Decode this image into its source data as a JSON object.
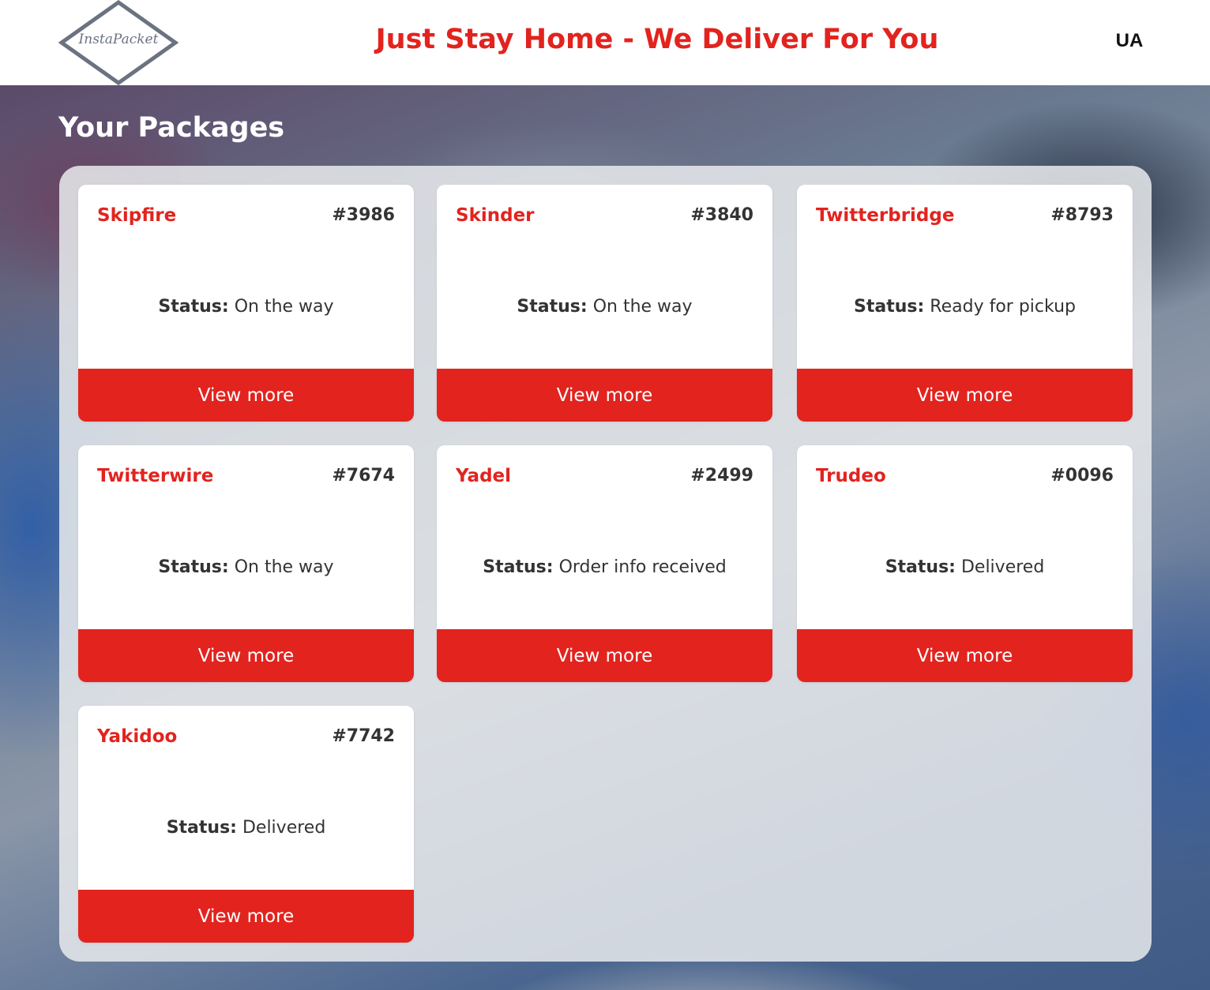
{
  "header": {
    "logo_text": "InstaPacket",
    "tagline": "Just Stay Home - We Deliver For You",
    "language": "UA"
  },
  "main": {
    "title": "Your Packages",
    "status_label": "Status:",
    "packages": [
      {
        "name": "Skipfire",
        "id": "#3986",
        "status": "On the way",
        "button": "View more"
      },
      {
        "name": "Skinder",
        "id": "#3840",
        "status": "On the way",
        "button": "View more"
      },
      {
        "name": "Twitterbridge",
        "id": "#8793",
        "status": "Ready for pickup",
        "button": "View more"
      },
      {
        "name": "Twitterwire",
        "id": "#7674",
        "status": "On the way",
        "button": "View more"
      },
      {
        "name": "Yadel",
        "id": "#2499",
        "status": "Order info received",
        "button": "View more"
      },
      {
        "name": "Trudeo",
        "id": "#0096",
        "status": "Delivered",
        "button": "View more"
      },
      {
        "name": "Yakidoo",
        "id": "#7742",
        "status": "Delivered",
        "button": "View more"
      }
    ]
  },
  "colors": {
    "accent": "#e2231e",
    "text": "#333333",
    "panel": "#e8eaec"
  }
}
